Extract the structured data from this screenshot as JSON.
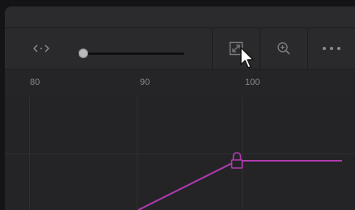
{
  "toolbar": {
    "code_icon": "code-brackets-icon",
    "fit_icon": "zoom-to-fit-icon",
    "zoom_icon": "zoom-in-icon",
    "more_icon": "more-options-icon",
    "zoom_slider_value": 0.05
  },
  "ruler": {
    "ticks": [
      "80",
      "90",
      "100"
    ]
  },
  "curve": {
    "color": "#b03bb0",
    "keyframe_icon": "lock-keyframe-icon"
  }
}
